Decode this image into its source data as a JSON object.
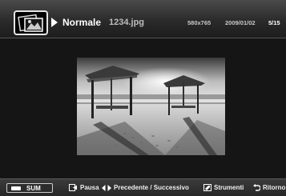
{
  "header": {
    "mode_label": "Normale",
    "filename": "1234.jpg",
    "resolution": "580x765",
    "date": "2009/01/02",
    "page": "5/15"
  },
  "footer": {
    "sum_label": "SUM",
    "pause_label": "Pausa",
    "prevnext_label": "Precedente / Successivo",
    "tools_label": "Strumenti",
    "return_label": "Ritorno"
  },
  "icons": {
    "photo_mode": "photo-frame-icon",
    "play": "play-icon",
    "pause": "pause-icon",
    "prevnext": "left-right-arrows-icon",
    "tools": "tools-icon",
    "return": "return-arrow-icon"
  }
}
